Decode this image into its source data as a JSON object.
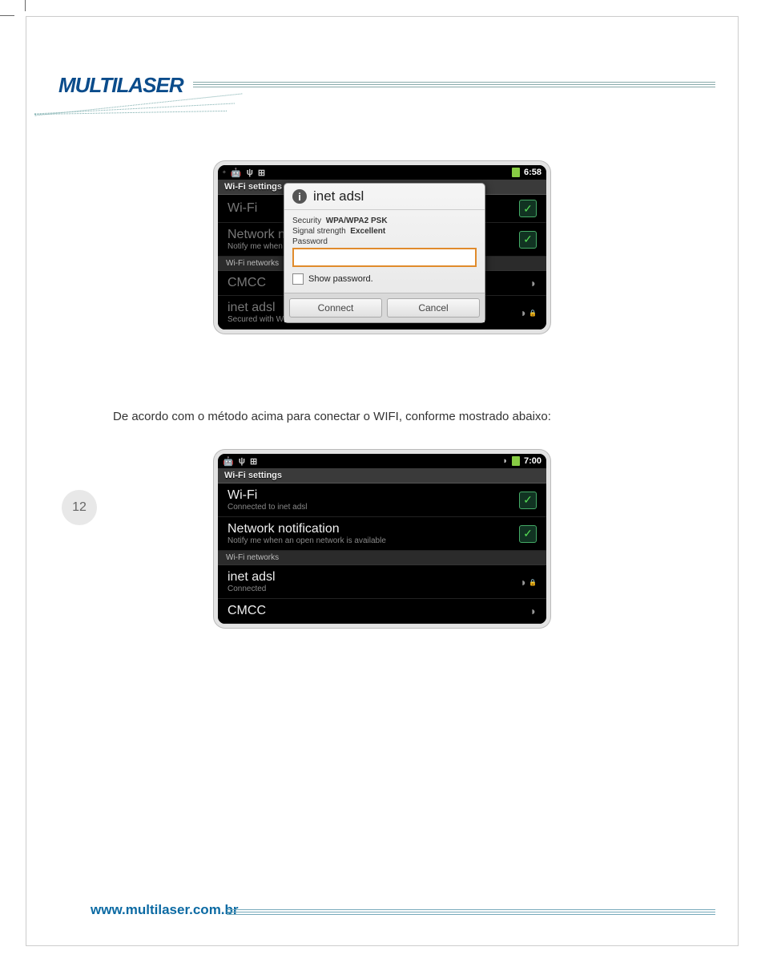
{
  "logo_text": "MULTILASER",
  "caption_text": "De acordo com o método acima para conectar o WIFI, conforme mostrado abaixo:",
  "page_number": "12",
  "footer_url": "www.multilaser.com.br",
  "device1": {
    "time": "6:58",
    "title": "Wi-Fi settings",
    "wifi_label": "Wi-Fi",
    "notif_title": "Network n",
    "notif_sub": "Notify me when",
    "section_label": "Wi-Fi networks",
    "net1_name": "CMCC",
    "net2_name": "inet adsl",
    "net2_sub": "Secured with WP",
    "dialog": {
      "title": "inet adsl",
      "security_label": "Security",
      "security_value": "WPA/WPA2 PSK",
      "signal_label": "Signal strength",
      "signal_value": "Excellent",
      "password_label": "Password",
      "show_password_label": "Show password.",
      "connect_label": "Connect",
      "cancel_label": "Cancel"
    }
  },
  "device2": {
    "time": "7:00",
    "title": "Wi-Fi settings",
    "wifi_label": "Wi-Fi",
    "wifi_sub": "Connected to inet adsl",
    "notif_title": "Network notification",
    "notif_sub": "Notify me when an open network is available",
    "section_label": "Wi-Fi networks",
    "net1_name": "inet adsl",
    "net1_sub": "Connected",
    "net2_name": "CMCC"
  }
}
